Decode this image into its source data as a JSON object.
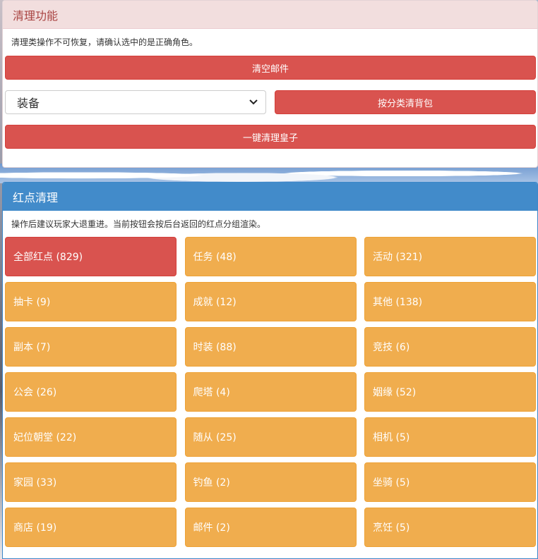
{
  "clear_panel": {
    "title": "清理功能",
    "hint": "清理类操作不可恢复，请确认选中的是正确角色。",
    "clear_mail_label": "清空邮件",
    "category_select_value": "装备",
    "clear_bag_label": "按分类清背包",
    "clear_prince_label": "一键清理皇子"
  },
  "red_panel": {
    "title": "红点清理",
    "hint": "操作后建议玩家大退重进。当前按钮会按后台返回的红点分组渲染。",
    "buttons": [
      {
        "label": "全部红点 (829)",
        "active": true
      },
      {
        "label": "任务 (48)"
      },
      {
        "label": "活动 (321)"
      },
      {
        "label": "抽卡 (9)"
      },
      {
        "label": "成就 (12)"
      },
      {
        "label": "其他 (138)"
      },
      {
        "label": "副本 (7)"
      },
      {
        "label": "时装 (88)"
      },
      {
        "label": "竞技 (6)"
      },
      {
        "label": "公会 (26)"
      },
      {
        "label": "爬塔 (4)"
      },
      {
        "label": "姻缘 (52)"
      },
      {
        "label": "妃位朝堂 (22)"
      },
      {
        "label": "随从 (25)"
      },
      {
        "label": "相机 (5)"
      },
      {
        "label": "家园 (33)"
      },
      {
        "label": "钓鱼 (2)"
      },
      {
        "label": "坐骑 (5)"
      },
      {
        "label": "商店 (19)"
      },
      {
        "label": "邮件 (2)"
      },
      {
        "label": "烹饪 (5)"
      }
    ]
  },
  "colors": {
    "danger": "#d9534f",
    "warning": "#f0ad4e",
    "primary": "#428bca",
    "danger_header_bg": "#f2dede",
    "danger_header_text": "#a94442"
  },
  "icons": {
    "select_arrow": "chevron-down-icon"
  }
}
